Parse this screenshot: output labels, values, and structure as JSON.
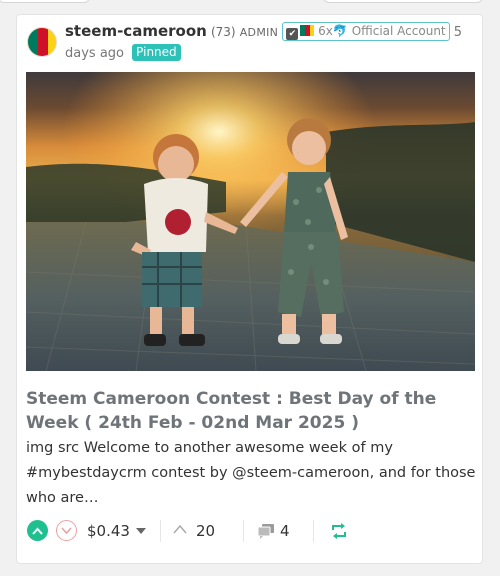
{
  "post": {
    "author": "steem-cameroon",
    "reputation": "(73)",
    "role": "ADMIN",
    "badge_text": "6x",
    "badge_label": "Official Account",
    "time_ago_num": "5",
    "time_ago_rest": "days ago",
    "pinned_label": "Pinned",
    "title": "Steem Cameroon Contest : Best Day of the Week ( 24th Feb - 02nd Mar 2025 )",
    "excerpt": "img src Welcome to another awesome week of my #mybestdaycrm contest by @steem-cameroon, and for those who are…",
    "payout": "$0.43",
    "votes": "20",
    "comments": "4"
  },
  "colors": {
    "accent": "#2ec1b8",
    "upvote": "#1fbf8f",
    "downvote_border": "#e6a4a4",
    "title": "#6f7479",
    "flag_green": "#007a5e",
    "flag_red": "#ce1126",
    "flag_yellow": "#fcd116"
  },
  "icons": {
    "upvote": "chevron-up-circle",
    "downvote": "chevron-down-circle",
    "votes": "chevron-up",
    "comments": "speech-bubbles",
    "resteem": "resteem-arrows"
  }
}
